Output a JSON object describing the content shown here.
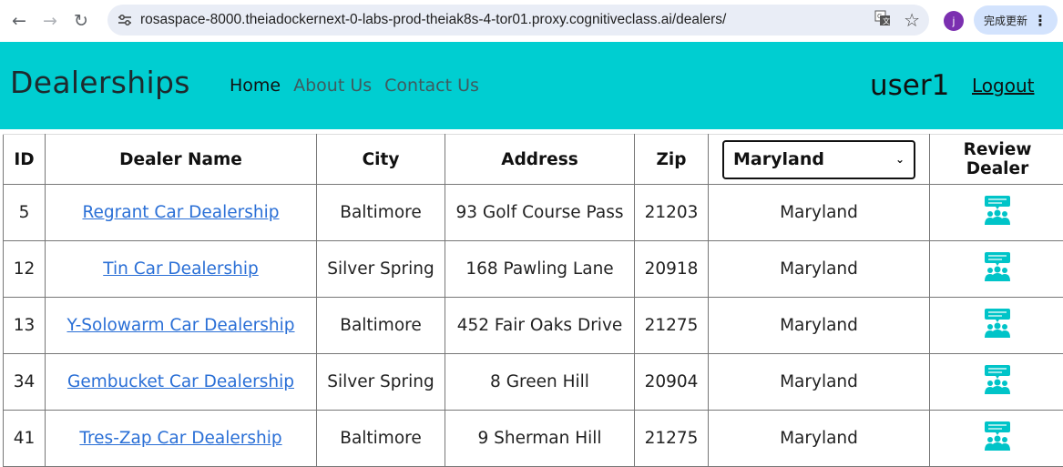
{
  "browser": {
    "url": "rosaspace-8000.theiadockernext-0-labs-prod-theiak8s-4-tor01.proxy.cognitiveclass.ai/dealers/",
    "profile_initial": "j",
    "update_label": "完成更新"
  },
  "header": {
    "brand": "Dealerships",
    "nav": [
      "Home",
      "About Us",
      "Contact Us"
    ],
    "username": "user1",
    "logout": "Logout",
    "bg_color": "#00ced1"
  },
  "table": {
    "columns": [
      "ID",
      "Dealer Name",
      "City",
      "Address",
      "Zip",
      "Review Dealer"
    ],
    "state_filter": "Maryland",
    "rows": [
      {
        "id": "5",
        "name": "Regrant Car Dealership",
        "city": "Baltimore",
        "address": "93 Golf Course Pass",
        "zip": "21203",
        "state": "Maryland"
      },
      {
        "id": "12",
        "name": "Tin Car Dealership",
        "city": "Silver Spring",
        "address": "168 Pawling Lane",
        "zip": "20918",
        "state": "Maryland"
      },
      {
        "id": "13",
        "name": "Y-Solowarm Car Dealership",
        "city": "Baltimore",
        "address": "452 Fair Oaks Drive",
        "zip": "21275",
        "state": "Maryland"
      },
      {
        "id": "34",
        "name": "Gembucket Car Dealership",
        "city": "Silver Spring",
        "address": "8 Green Hill",
        "zip": "20904",
        "state": "Maryland"
      },
      {
        "id": "41",
        "name": "Tres-Zap Car Dealership",
        "city": "Baltimore",
        "address": "9 Sherman Hill",
        "zip": "21275",
        "state": "Maryland"
      }
    ],
    "review_icon": "review-dealer-icon",
    "accent_color": "#00c4c8"
  }
}
